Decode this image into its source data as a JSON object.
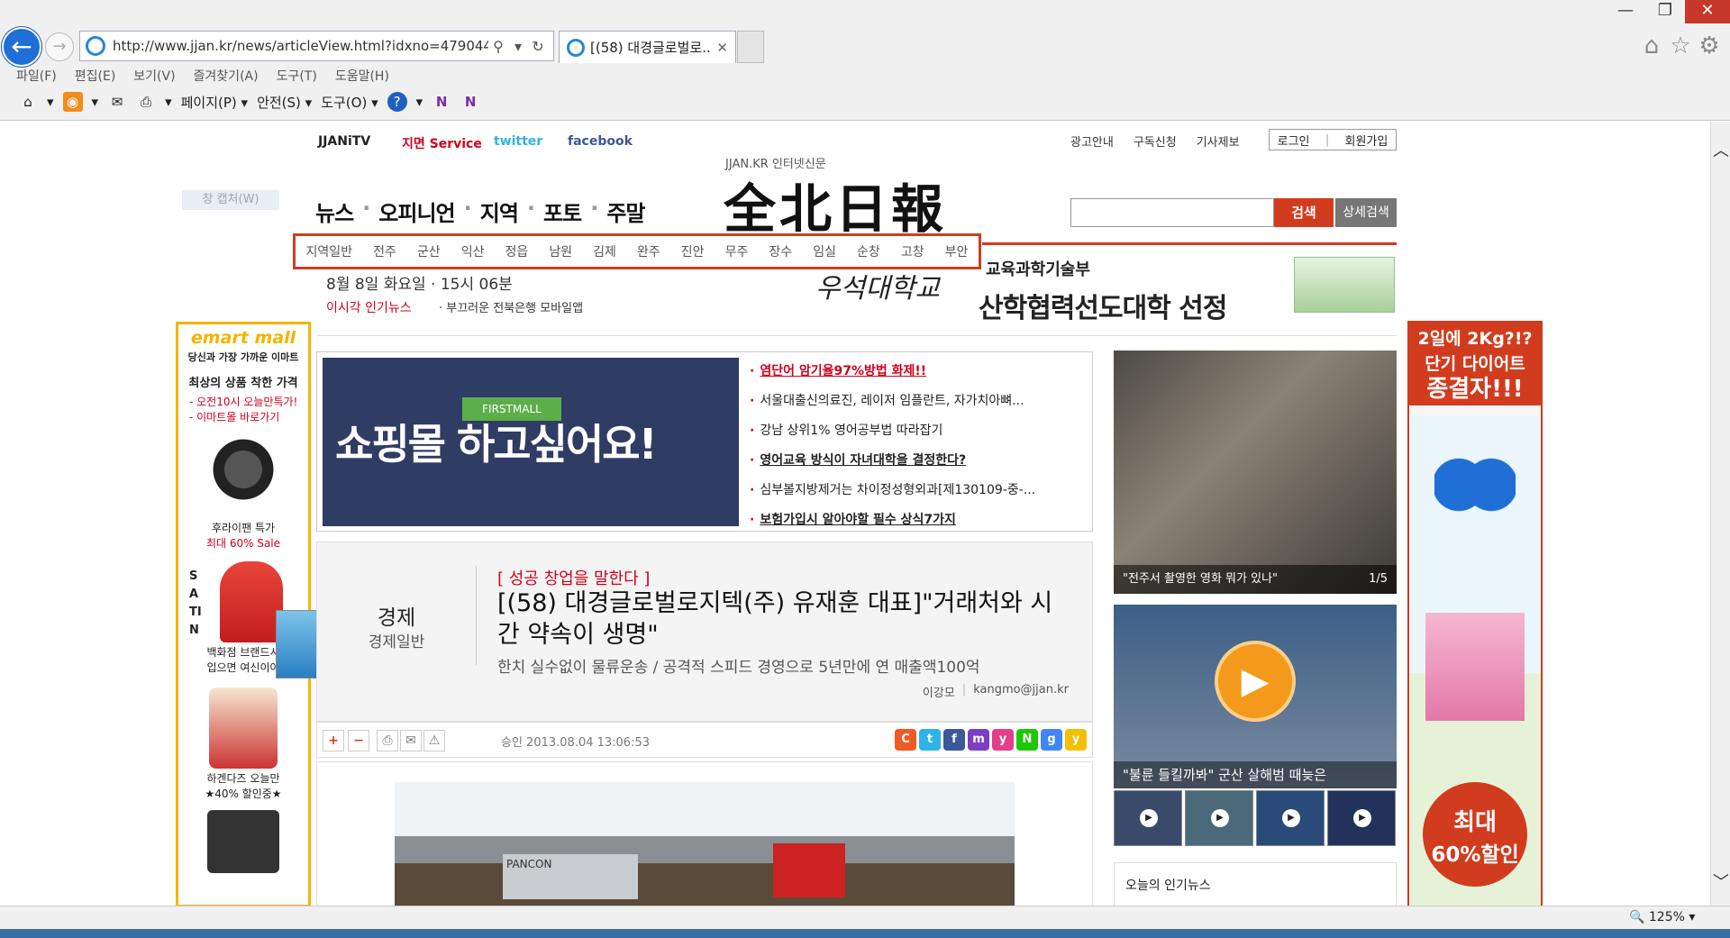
{
  "browser": {
    "url": "http://www.jjan.kr/news/articleView.html?idxno=479044",
    "tab_title": "[(58) 대경글로벌로...",
    "menu": [
      "파일(F)",
      "편집(E)",
      "보기(V)",
      "즐겨찾기(A)",
      "도구(T)",
      "도움말(H)"
    ],
    "cmd": {
      "page": "페이지(P)",
      "safety": "안전(S)",
      "tools": "도구(O)"
    },
    "zoom": "125%"
  },
  "site": {
    "top_brands": {
      "jjantv": "JJANiTV",
      "service": "지면 Service",
      "twitter": "twitter",
      "facebook": "facebook"
    },
    "top_links": [
      "광고안내",
      "구독신청",
      "기사제보"
    ],
    "login": "로그인",
    "join": "회원가입",
    "logo_sub": "JJAN.KR 인터넷신문",
    "logo": "全北日報",
    "capture": "창 캡처(W)",
    "nav": [
      "뉴스",
      "오피니언",
      "지역",
      "포토",
      "주말"
    ],
    "subnav": [
      "지역일반",
      "전주",
      "군산",
      "익산",
      "정읍",
      "남원",
      "김제",
      "완주",
      "진안",
      "무주",
      "장수",
      "임실",
      "순창",
      "고창",
      "부안"
    ],
    "search_btn": "검색",
    "search_detail": "상세검색",
    "date_line": "8월 8일 화요일 · 15시 06분",
    "popular_label": "이시각 인기뉴스",
    "popular_item": "부끄러운 전북은행 모바일앱",
    "univ_ad": {
      "logo": "우석대학교",
      "line1": "교육과학기술부",
      "line2": "산학협력선도대학 선정"
    }
  },
  "left_ad": {
    "brand": "emart mall",
    "slogan": "당신과 가장 가까운 이마트",
    "title": "최상의 상품 착한 가격",
    "lines": [
      "- 오전10시 오늘만특가!",
      "- 이마트몰 바로가기"
    ],
    "item1": [
      "후라이팬 특가",
      "최대 60% Sale"
    ],
    "satin": "SATIN",
    "item2": [
      "백화점 브랜드시",
      "입으면 여신이야"
    ],
    "item3": [
      "하겐다즈 오늘만",
      "★40% 할인중★"
    ]
  },
  "promo": {
    "banner_text": "쇼핑몰 하고싶어요!",
    "banner_sign": "FIRSTMALL",
    "links": [
      "염단어 암기율97%방법 화제!!",
      "서울대출신의료진, 레이저 임플란트, 자가치아뼈...",
      "강남 상위1% 영어공부법 따라잡기",
      "영어교육 방식이 자녀대학을 결정한다?",
      "심부볼지방제거는 차이정성형외과[제130109-중-...",
      "보험가입시 알아야할 필수 상식7가지"
    ]
  },
  "article": {
    "section": "경제",
    "subsection": "경제일반",
    "kicker": "[ 성공 창업을 말한다 ]",
    "title": "[(58) 대경글로벌로지텍(주) 유재훈 대표]\"거래처와 시간 약속이 생명\"",
    "subtitle": "한치 실수없이 물류운송 / 공격적 스피드 경영으로 5년만에 연 매출액100억",
    "author": "이강모",
    "email": "kangmo@jjan.kr",
    "approved": "승인 2013.08.04  13:06:53",
    "photo_text": "PANCON"
  },
  "right_col": {
    "photo_caption": "\"전주서 촬영한 영화 뭐가 있나\"",
    "photo_count": "1/5",
    "video_caption": "\"불륜 들킬까봐\" 군산 살해범 때늦은",
    "today_label": "오늘의 인기뉴스"
  },
  "right_ad": {
    "line1": "2일에 2Kg?!?",
    "line2": "단기 다이어트",
    "line3": "종결자!!!",
    "sale1": "최대",
    "sale2": "60%할인"
  }
}
